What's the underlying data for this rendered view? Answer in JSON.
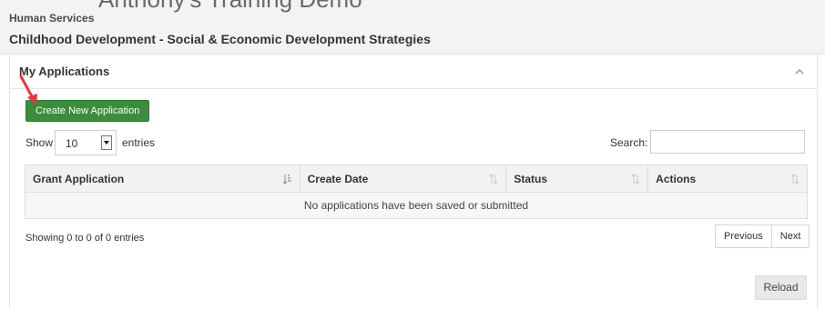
{
  "header": {
    "app_name": "Anthony's Training Demo",
    "organization": "Human Services",
    "program": "Childhood Development - Social & Economic Development Strategies"
  },
  "panel": {
    "title": "My Applications",
    "create_button": "Create New Application",
    "show_label": "Show",
    "entries_value": "10",
    "entries_label": "entries",
    "search_label": "Search:",
    "search_value": "",
    "columns": [
      "Grant Application",
      "Create Date",
      "Status",
      "Actions"
    ],
    "empty_message": "No applications have been saved or submitted",
    "info": "Showing 0 to 0 of 0 entries",
    "prev_label": "Previous",
    "next_label": "Next",
    "reload_label": "Reload"
  },
  "colors": {
    "accent_green": "#3b8c3b",
    "annotation_arrow": "#e03a3a"
  }
}
